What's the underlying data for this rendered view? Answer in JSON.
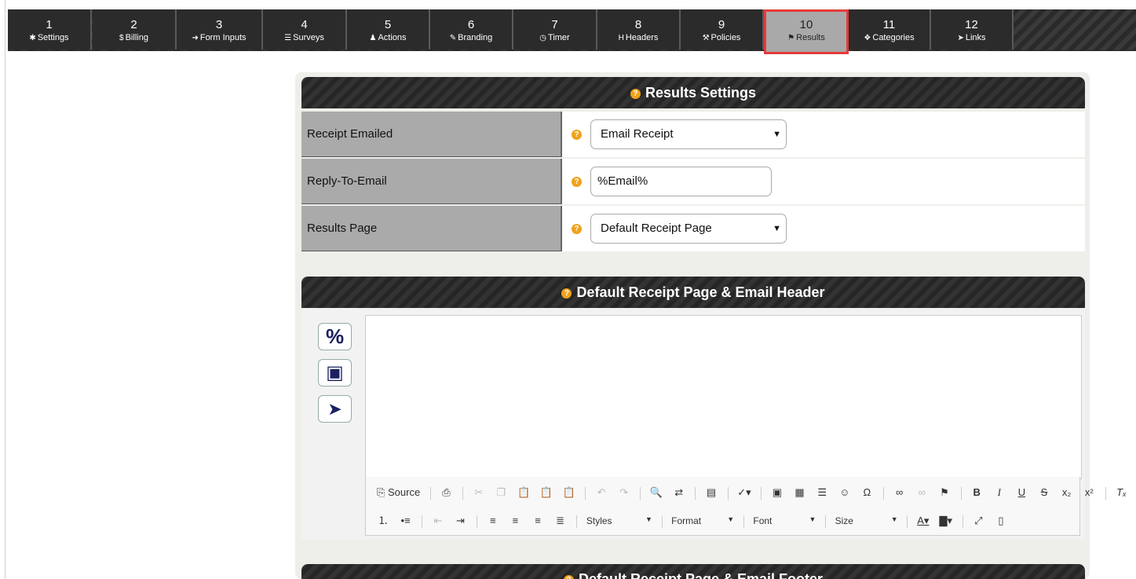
{
  "tabs": [
    {
      "num": "1",
      "label": "Settings",
      "icon": "gear-icon",
      "glyph": "✱"
    },
    {
      "num": "2",
      "label": "Billing",
      "icon": "dollar-icon",
      "glyph": "$"
    },
    {
      "num": "3",
      "label": "Form Inputs",
      "icon": "sign-in-icon",
      "glyph": "➜"
    },
    {
      "num": "4",
      "label": "Surveys",
      "icon": "list-icon",
      "glyph": "☰"
    },
    {
      "num": "5",
      "label": "Actions",
      "icon": "user-icon",
      "glyph": "♟"
    },
    {
      "num": "6",
      "label": "Branding",
      "icon": "brush-icon",
      "glyph": "✎"
    },
    {
      "num": "7",
      "label": "Timer",
      "icon": "clock-icon",
      "glyph": "◷"
    },
    {
      "num": "8",
      "label": "Headers",
      "icon": "heading-icon",
      "glyph": "H"
    },
    {
      "num": "9",
      "label": "Policies",
      "icon": "gavel-icon",
      "glyph": "⚒"
    },
    {
      "num": "10",
      "label": "Results",
      "icon": "flag-icon",
      "glyph": "⚑"
    },
    {
      "num": "11",
      "label": "Categories",
      "icon": "cubes-icon",
      "glyph": "❖"
    },
    {
      "num": "12",
      "label": "Links",
      "icon": "pointer-icon",
      "glyph": "➤"
    }
  ],
  "results": {
    "title": "Results Settings",
    "rows": [
      {
        "label": "Receipt Emailed",
        "value": "Email Receipt",
        "kind": "select"
      },
      {
        "label": "Reply-To-Email",
        "value": "%Email%",
        "kind": "input"
      },
      {
        "label": "Results Page",
        "value": "Default Receipt Page",
        "kind": "select"
      }
    ]
  },
  "header_editor": {
    "title": "Default Receipt Page & Email Header",
    "side_buttons": [
      {
        "icon": "percent-icon",
        "glyph": "%"
      },
      {
        "icon": "image-icon",
        "glyph": "▣"
      },
      {
        "icon": "pointer-icon",
        "glyph": "➤"
      }
    ],
    "toolbar": {
      "source": "Source",
      "styles": "Styles",
      "format": "Format",
      "font": "Font",
      "size": "Size"
    }
  },
  "footer_editor": {
    "title": "Default Receipt Page & Email Footer"
  },
  "colors": {
    "active_tab_border": "#e53b3b",
    "help_icon": "#f0a21c",
    "row_label_bg": "#aaaaaa"
  }
}
